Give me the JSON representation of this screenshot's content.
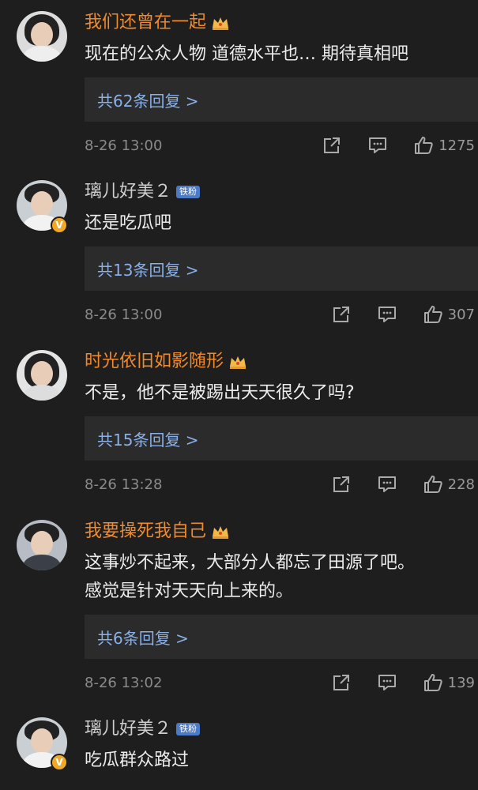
{
  "comments": [
    {
      "name": "我们还曾在一起",
      "text": "现在的公众人物 道德水平也…  期待真相吧",
      "reply_text": "共62条回复 >",
      "time": "8-26 13:00",
      "likes": "1275"
    },
    {
      "name": "璃儿好美２",
      "badge": "铁粉",
      "verified": "V",
      "text": "还是吃瓜吧",
      "reply_text": "共13条回复 >",
      "time": "8-26 13:00",
      "likes": "307"
    },
    {
      "name": "时光依旧如影随形",
      "text": "不是，他不是被踢出天天很久了吗?",
      "reply_text": "共15条回复 >",
      "time": "8-26 13:28",
      "likes": "228"
    },
    {
      "name": "我要操死我自己",
      "text_line1": "这事炒不起来，大部分人都忘了田源了吧。",
      "text_line2": "感觉是针对天天向上来的。",
      "reply_text": "共6条回复 >",
      "time": "8-26 13:02",
      "likes": "139"
    },
    {
      "name": "璃儿好美２",
      "badge": "铁粉",
      "verified": "V",
      "text": "吃瓜群众路过"
    }
  ],
  "colors": {
    "background": "#1e1e1e",
    "vip_name": "#f08a2c",
    "reply_link": "#8ab0e8",
    "reply_bg": "#2b2b2b",
    "meta": "#8a8a8a",
    "fan_badge": "#4a7ac8",
    "verified": "#f3a825"
  },
  "icons": {
    "share": "share-icon",
    "comment": "comment-icon",
    "like": "like-icon",
    "crown": "crown-icon"
  }
}
